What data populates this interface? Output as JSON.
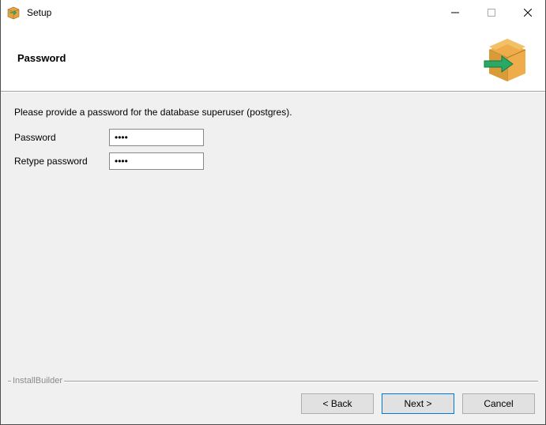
{
  "window": {
    "title": "Setup"
  },
  "header": {
    "title": "Password"
  },
  "content": {
    "instruction": "Please provide a password for the database superuser (postgres).",
    "password": {
      "label": "Password",
      "value": "abcd"
    },
    "retype": {
      "label": "Retype password",
      "value": "abcd"
    }
  },
  "footer": {
    "brand": "InstallBuilder",
    "back": "< Back",
    "next": "Next >",
    "cancel": "Cancel"
  }
}
